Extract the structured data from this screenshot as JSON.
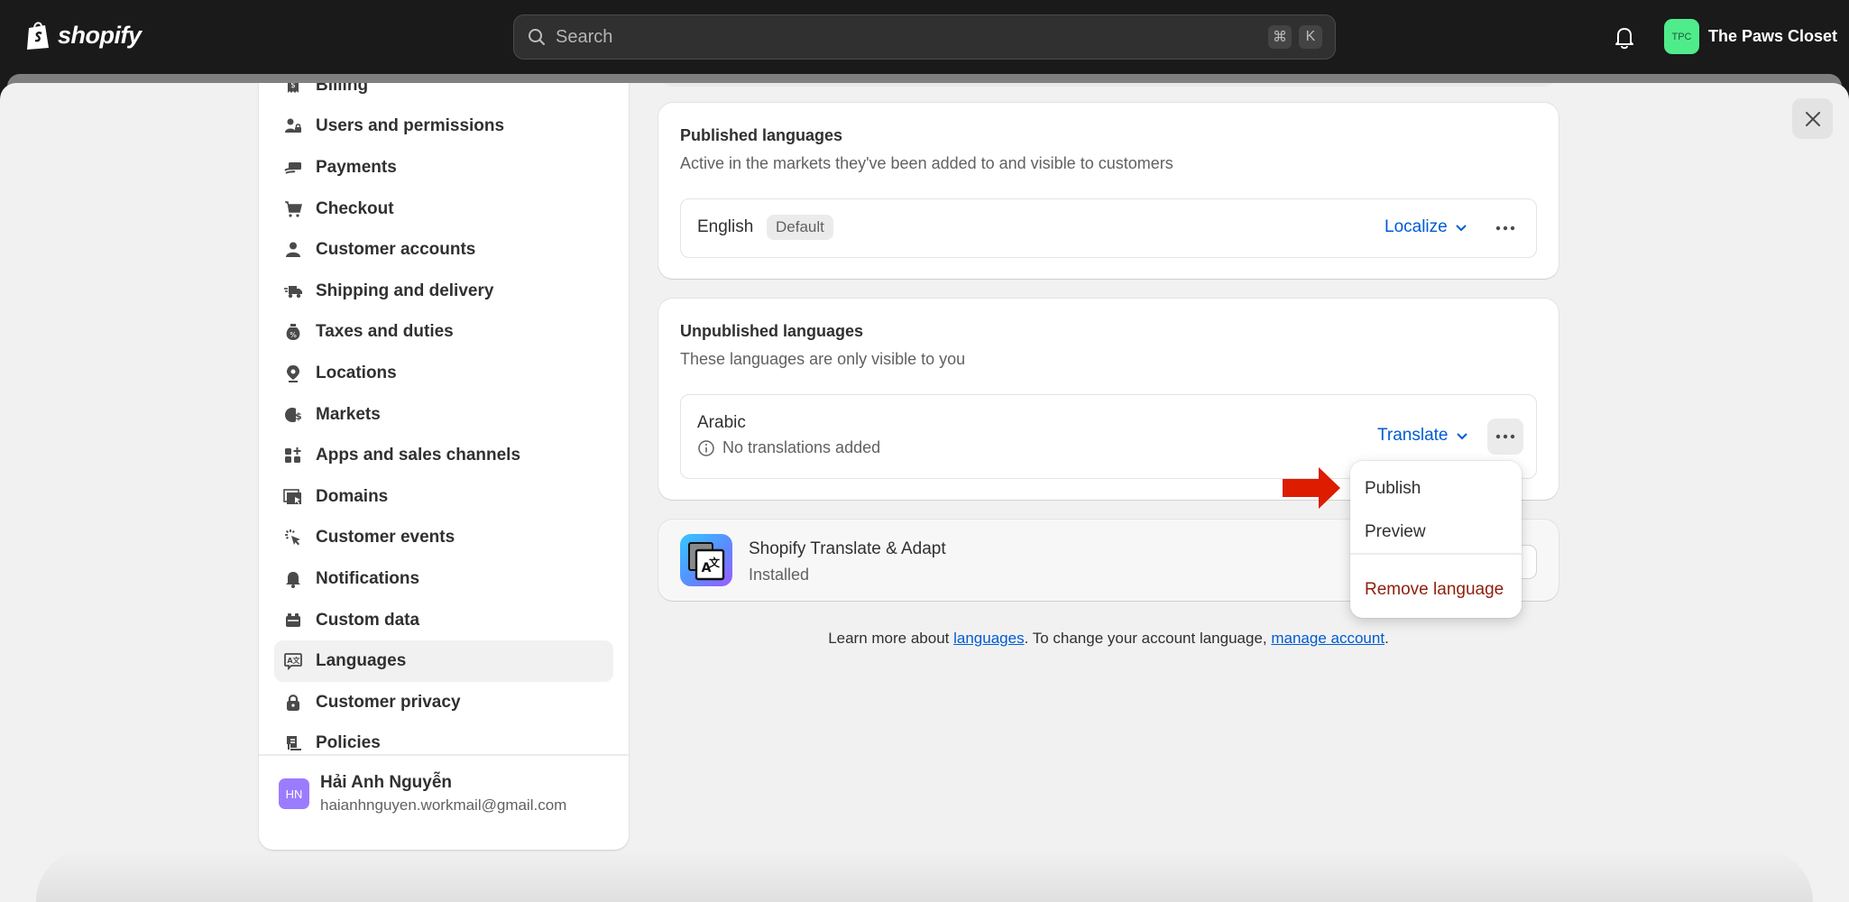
{
  "topbar": {
    "brand": "shopify",
    "search_placeholder": "Search",
    "shortcut_keys": [
      "⌘",
      "K"
    ],
    "store_initials": "TPC",
    "store_name": "The Paws Closet",
    "colors": {
      "store_avatar": "#4fec8c"
    }
  },
  "sidebar": {
    "items": [
      {
        "label": "Billing",
        "icon": "billing-icon"
      },
      {
        "label": "Users and permissions",
        "icon": "users-icon"
      },
      {
        "label": "Payments",
        "icon": "payments-icon"
      },
      {
        "label": "Checkout",
        "icon": "cart-icon"
      },
      {
        "label": "Customer accounts",
        "icon": "person-icon"
      },
      {
        "label": "Shipping and delivery",
        "icon": "truck-icon"
      },
      {
        "label": "Taxes and duties",
        "icon": "tax-bag-icon"
      },
      {
        "label": "Locations",
        "icon": "location-pin-icon"
      },
      {
        "label": "Markets",
        "icon": "globe-dollar-icon"
      },
      {
        "label": "Apps and sales channels",
        "icon": "apps-icon"
      },
      {
        "label": "Domains",
        "icon": "domains-icon"
      },
      {
        "label": "Customer events",
        "icon": "cursor-click-icon"
      },
      {
        "label": "Notifications",
        "icon": "bell-icon"
      },
      {
        "label": "Custom data",
        "icon": "custom-data-icon"
      },
      {
        "label": "Languages",
        "icon": "language-icon",
        "active": true
      },
      {
        "label": "Customer privacy",
        "icon": "lock-icon"
      },
      {
        "label": "Policies",
        "icon": "policies-icon"
      }
    ],
    "user": {
      "initials": "HN",
      "name": "Hải Anh Nguyễn",
      "email": "haianhnguyen.workmail@gmail.com",
      "avatar_color": "#9b7cff"
    }
  },
  "published": {
    "title": "Published languages",
    "subtitle": "Active in the markets they've been added to and visible to customers",
    "languages": [
      {
        "name": "English",
        "badge": "Default",
        "action": "Localize"
      }
    ]
  },
  "unpublished": {
    "title": "Unpublished languages",
    "subtitle": "These languages are only visible to you",
    "languages": [
      {
        "name": "Arabic",
        "status": "No translations added",
        "action": "Translate"
      }
    ]
  },
  "app": {
    "name": "Shopify Translate & Adapt",
    "status": "Installed"
  },
  "footer": {
    "prefix": "Learn more about ",
    "link1": "languages",
    "middle": ". To change your account language, ",
    "link2": "manage account",
    "suffix": "."
  },
  "menu": {
    "items": [
      {
        "label": "Publish"
      },
      {
        "label": "Preview"
      },
      {
        "label": "Remove language",
        "danger": true
      }
    ]
  },
  "colors": {
    "link": "#005bd3",
    "danger": "#8e1f0b",
    "annotation_arrow": "#dd1c00"
  }
}
